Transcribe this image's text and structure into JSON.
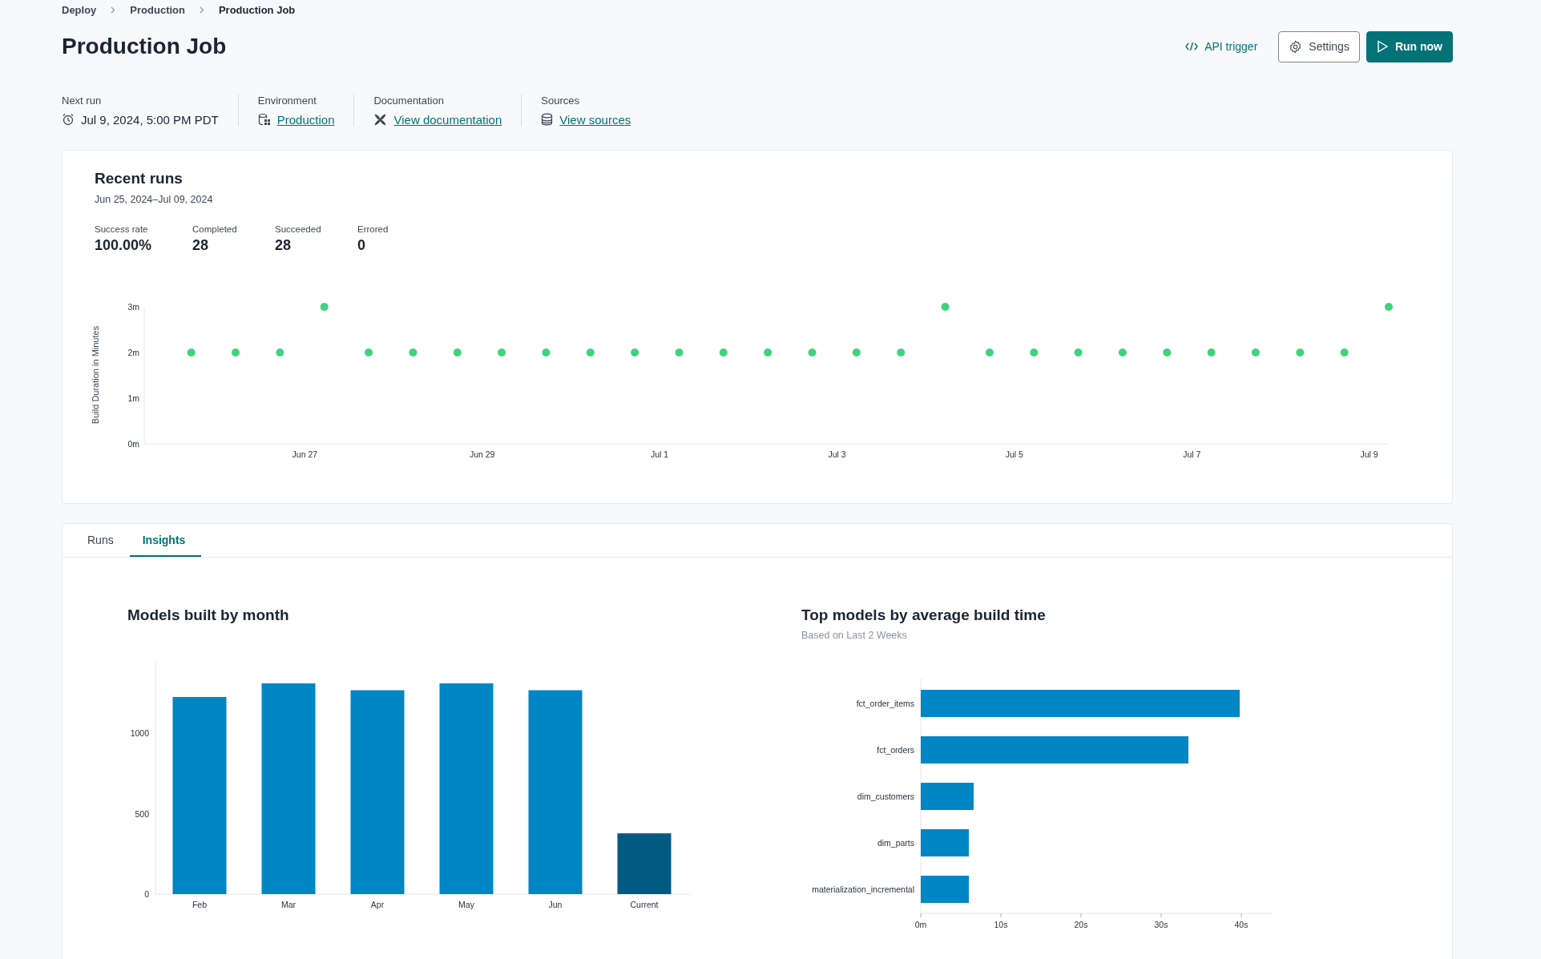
{
  "breadcrumbs": [
    {
      "label": "Deploy",
      "current": false
    },
    {
      "label": "Production",
      "current": false
    },
    {
      "label": "Production Job",
      "current": true
    }
  ],
  "title": "Production Job",
  "actions": [
    {
      "label": "API trigger",
      "kind": "link"
    },
    {
      "label": "Settings",
      "kind": "secondary"
    },
    {
      "label": "Run now",
      "kind": "primary"
    }
  ],
  "meta": [
    {
      "label": "Next run",
      "value": "Jul 9, 2024, 5:00 PM PDT",
      "kind": "text"
    },
    {
      "label": "Environment",
      "value": "Production",
      "kind": "environment"
    },
    {
      "label": "Documentation",
      "value": "View documentation",
      "kind": "docs"
    },
    {
      "label": "Sources",
      "value": "View sources",
      "kind": "sources"
    }
  ],
  "recent_runs": {
    "title": "Recent runs",
    "range": "Jun 25, 2024–Jul 09, 2024",
    "stats": [
      {
        "label": "Success rate",
        "value": "100.00%"
      },
      {
        "label": "Completed",
        "value": "28"
      },
      {
        "label": "Succeeded",
        "value": "28"
      },
      {
        "label": "Errored",
        "value": "0"
      }
    ],
    "chart_data": {
      "type": "scatter",
      "ylabel": "Build Duration in Minutes",
      "x": [
        "2024-06-25T17:17",
        "2024-06-26T05:17",
        "2024-06-26T17:17",
        "2024-06-27T05:17",
        "2024-06-27T17:17",
        "2024-06-28T05:17",
        "2024-06-28T17:17",
        "2024-06-29T05:17",
        "2024-06-29T17:17",
        "2024-06-30T05:17",
        "2024-06-30T17:17",
        "2024-07-01T05:17",
        "2024-07-01T17:17",
        "2024-07-02T05:17",
        "2024-07-02T17:17",
        "2024-07-03T05:17",
        "2024-07-03T17:17",
        "2024-07-04T05:17",
        "2024-07-04T17:17",
        "2024-07-05T05:17",
        "2024-07-05T17:17",
        "2024-07-06T05:17",
        "2024-07-06T17:17",
        "2024-07-07T05:17",
        "2024-07-07T17:17",
        "2024-07-08T05:17",
        "2024-07-08T17:17",
        "2024-07-09T05:17"
      ],
      "series": [
        {
          "color": "#3ed47c",
          "values": [
            2,
            2,
            2,
            3,
            2,
            2,
            2,
            2,
            2,
            2,
            2,
            2,
            2,
            2,
            2,
            2,
            2,
            3,
            2,
            2,
            2,
            2,
            2,
            2,
            2,
            2,
            2,
            3
          ]
        }
      ],
      "xlim": [
        "2024-06-25T04:34",
        "2024-07-09T05:17"
      ],
      "ylim": [
        0,
        3
      ],
      "xticks": [
        {
          "value": "2024-06-27T00:00",
          "label": "Jun 27"
        },
        {
          "value": "2024-06-29T00:00",
          "label": "Jun 29"
        },
        {
          "value": "2024-07-01T00:00",
          "label": "Jul 1"
        },
        {
          "value": "2024-07-03T00:00",
          "label": "Jul 3"
        },
        {
          "value": "2024-07-05T00:00",
          "label": "Jul 5"
        },
        {
          "value": "2024-07-07T00:00",
          "label": "Jul 7"
        },
        {
          "value": "2024-07-09T00:00",
          "label": "Jul 9"
        }
      ],
      "yticks": [
        {
          "value": 0,
          "label": "0m"
        },
        {
          "value": 1,
          "label": "1m"
        },
        {
          "value": 2,
          "label": "2m"
        },
        {
          "value": 3,
          "label": "3m"
        }
      ]
    }
  },
  "tabs": [
    {
      "label": "Runs",
      "selected": false
    },
    {
      "label": "Insights",
      "selected": true
    }
  ],
  "models_by_month": {
    "chart_data": {
      "type": "bar",
      "title": "Models built by month",
      "categories": [
        "Feb",
        "Mar",
        "Apr",
        "May",
        "Jun",
        "Current"
      ],
      "stacked": true,
      "series": [
        {
          "color": "#0086c4",
          "values": [
            1226,
            1311,
            1268,
            1311,
            1268,
            null
          ]
        },
        {
          "color": "#005a82",
          "values": [
            null,
            null,
            null,
            null,
            null,
            378
          ]
        }
      ],
      "ylim": [
        0,
        1450
      ],
      "yticks": [
        0,
        500,
        1000
      ]
    }
  },
  "top_models": {
    "subtitle": "Based on Last 2 Weeks",
    "chart_data": {
      "type": "bar",
      "orientation": "horizontal",
      "title": "Top models by average build time",
      "categories": [
        "fct_order_items",
        "fct_orders",
        "dim_customers",
        "dim_parts",
        "materialization_incremental"
      ],
      "series": [
        {
          "color": "#0086c4",
          "values": [
            39.8,
            33.4,
            6.6,
            6.0,
            6.0
          ]
        }
      ],
      "xlim": [
        0,
        43.8
      ],
      "xticks": [
        {
          "value": 0,
          "label": "0m"
        },
        {
          "value": 10,
          "label": "10s"
        },
        {
          "value": 20,
          "label": "20s"
        },
        {
          "value": 30,
          "label": "30s"
        },
        {
          "value": 40,
          "label": "40s"
        }
      ]
    }
  }
}
